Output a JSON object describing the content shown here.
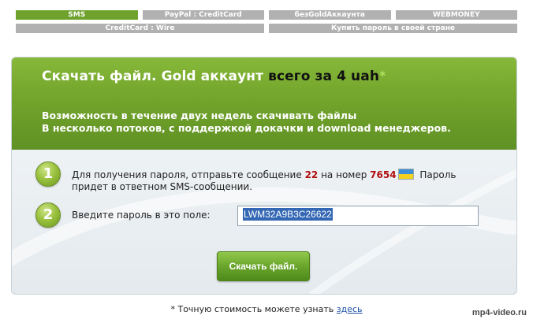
{
  "tabs": {
    "row1": [
      "SMS",
      "PayPal : CreditCard",
      "безGoldАккаунта",
      "WEBMONEY"
    ],
    "row2": [
      "CreditCard : Wire",
      "Купить пароль в своей стране"
    ]
  },
  "banner": {
    "title_main": "Скачать файл. Gold аккаунт ",
    "title_accent": "всего за 4 uah",
    "title_star": "*",
    "desc_line1": "Возможность в течение двух недель скачивать файлы",
    "desc_line2": "В несколько потоков, с поддержкой докачки и download менеджеров."
  },
  "step1": {
    "number": "1",
    "text_a": "Для получения пароля, отправьте сообщение ",
    "code": "22",
    "text_b": " на номер ",
    "phone": "7654",
    "text_c": " Пароль придет в ответном SMS-сообщении."
  },
  "step2": {
    "number": "2",
    "label": "Введите пароль в это поле:",
    "value": "LWM32A9B3C26622"
  },
  "download_button": "Скачать файл.",
  "footnote": {
    "text": "* Точную стоимость можете узнать ",
    "link": "здесь"
  },
  "watermark": "mp4-video.ru",
  "colors": {
    "active_tab": "#6ea22c",
    "inactive_tab": "#b1b1b1",
    "banner_green": "#73a42b",
    "highlight_red": "#b10d0d"
  }
}
